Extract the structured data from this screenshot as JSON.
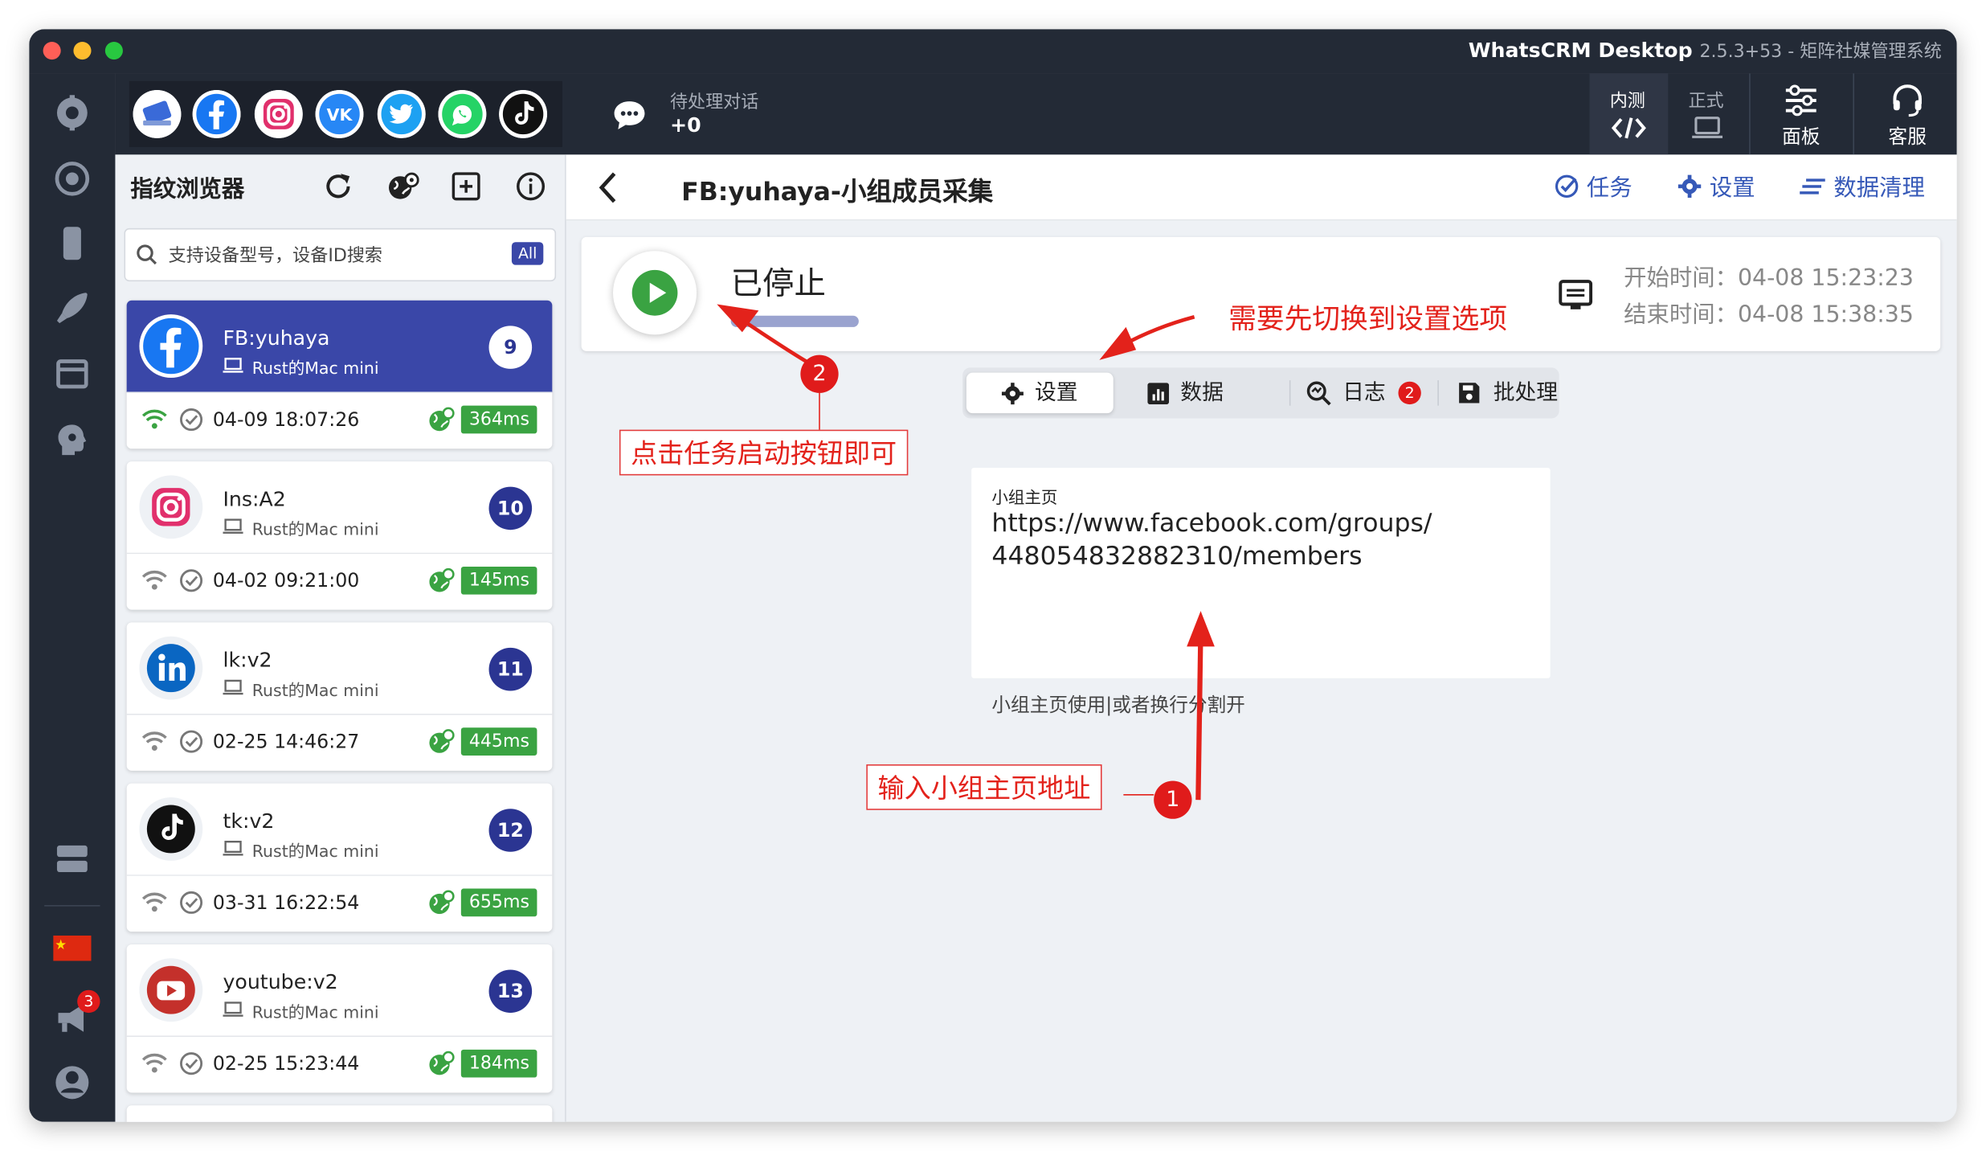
{
  "window": {
    "app_name": "WhatsCRM Desktop",
    "version_text": "2.5.3+53 - 矩阵社媒管理系统"
  },
  "topbar": {
    "pending_label": "待处理对话",
    "pending_count": "+0",
    "env_beta": "内测",
    "env_prod": "正式",
    "panel_label": "面板",
    "service_label": "客服"
  },
  "sidebar": {
    "title": "指纹浏览器",
    "search_placeholder": "支持设备型号，设备ID搜索",
    "filter_badge": "All",
    "devices": [
      {
        "name": "FB:yuhaya",
        "device": "Rust的Mac mini",
        "number": "9",
        "time": "04-09 18:07:26",
        "latency": "364ms",
        "icon": "facebook-icon"
      },
      {
        "name": "Ins:A2",
        "device": "Rust的Mac mini",
        "number": "10",
        "time": "04-02 09:21:00",
        "latency": "145ms",
        "icon": "instagram-icon"
      },
      {
        "name": "lk:v2",
        "device": "Rust的Mac mini",
        "number": "11",
        "time": "02-25 14:46:27",
        "latency": "445ms",
        "icon": "linkedin-icon"
      },
      {
        "name": "tk:v2",
        "device": "Rust的Mac mini",
        "number": "12",
        "time": "03-31 16:22:54",
        "latency": "655ms",
        "icon": "tiktok-icon"
      },
      {
        "name": "youtube:v2",
        "device": "Rust的Mac mini",
        "number": "13",
        "time": "02-25 15:23:44",
        "latency": "184ms",
        "icon": "youtube-icon"
      }
    ]
  },
  "leftbar": {
    "notification_count": "3"
  },
  "main": {
    "page_title": "FB:yuhaya-小组成员采集",
    "actions": {
      "task": "任务",
      "settings": "设置",
      "clear": "数据清理"
    },
    "status": {
      "text": "已停止",
      "start_time": "开始时间：04-08 15:23:23",
      "end_time": "结束时间：04-08 15:38:35"
    },
    "tabs": {
      "settings": "设置",
      "data": "数据",
      "log": "日志",
      "log_badge": "2",
      "batch": "批处理"
    },
    "form": {
      "field_label": "小组主页",
      "field_value_line1": "https://www.facebook.com/groups/",
      "field_value_line2": "448054832882310/members",
      "help_text": "小组主页使用|或者换行分割开"
    }
  },
  "annotations": {
    "note_switch": "需要先切换到设置选项",
    "note_start": "点击任务启动按钮即可",
    "note_input": "输入小组主页地址",
    "step1": "1",
    "step2": "2"
  },
  "colors": {
    "dark_bg": "#232a36",
    "active_card": "#3a47a8",
    "badge_blue": "#2b3592",
    "latency_green": "#3aa342",
    "annotation_red": "#e3221b",
    "link_blue": "#3659b8"
  }
}
